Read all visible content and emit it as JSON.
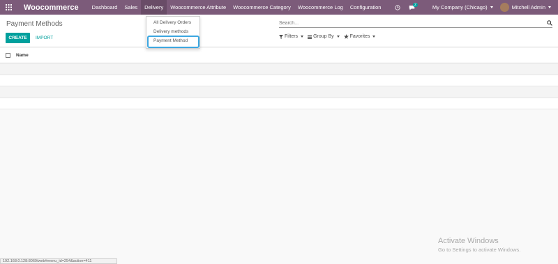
{
  "navbar": {
    "brand": "Woocommerce",
    "menu": [
      {
        "label": "Dashboard"
      },
      {
        "label": "Sales"
      },
      {
        "label": "Delivery"
      },
      {
        "label": "Woocommerce Attribute"
      },
      {
        "label": "Woocommerce Category"
      },
      {
        "label": "Woocommerce Log"
      },
      {
        "label": "Configuration"
      }
    ],
    "message_count": "2",
    "company": "My Company (Chicago)",
    "user": "Mitchell Admin"
  },
  "dropdown": {
    "items": [
      {
        "label": "All Delivery Orders"
      },
      {
        "label": "Delivery methods"
      },
      {
        "label": "Payment Method"
      }
    ]
  },
  "control_panel": {
    "title": "Payment Methods",
    "create_label": "CREATE",
    "import_label": "IMPORT",
    "search_placeholder": "Search...",
    "filters_label": "Filters",
    "groupby_label": "Group By",
    "favorites_label": "Favorites"
  },
  "list": {
    "column_name": "Name",
    "rows": 4
  },
  "watermark": {
    "line1": "Activate Windows",
    "line2": "Go to Settings to activate Windows."
  },
  "statusbar": {
    "url": "192.168.0.128:8069/web#menu_id=254&action=411"
  },
  "colors": {
    "navbar": "#7c5b7a",
    "primary": "#00a09d",
    "highlight": "#3da7e0"
  }
}
